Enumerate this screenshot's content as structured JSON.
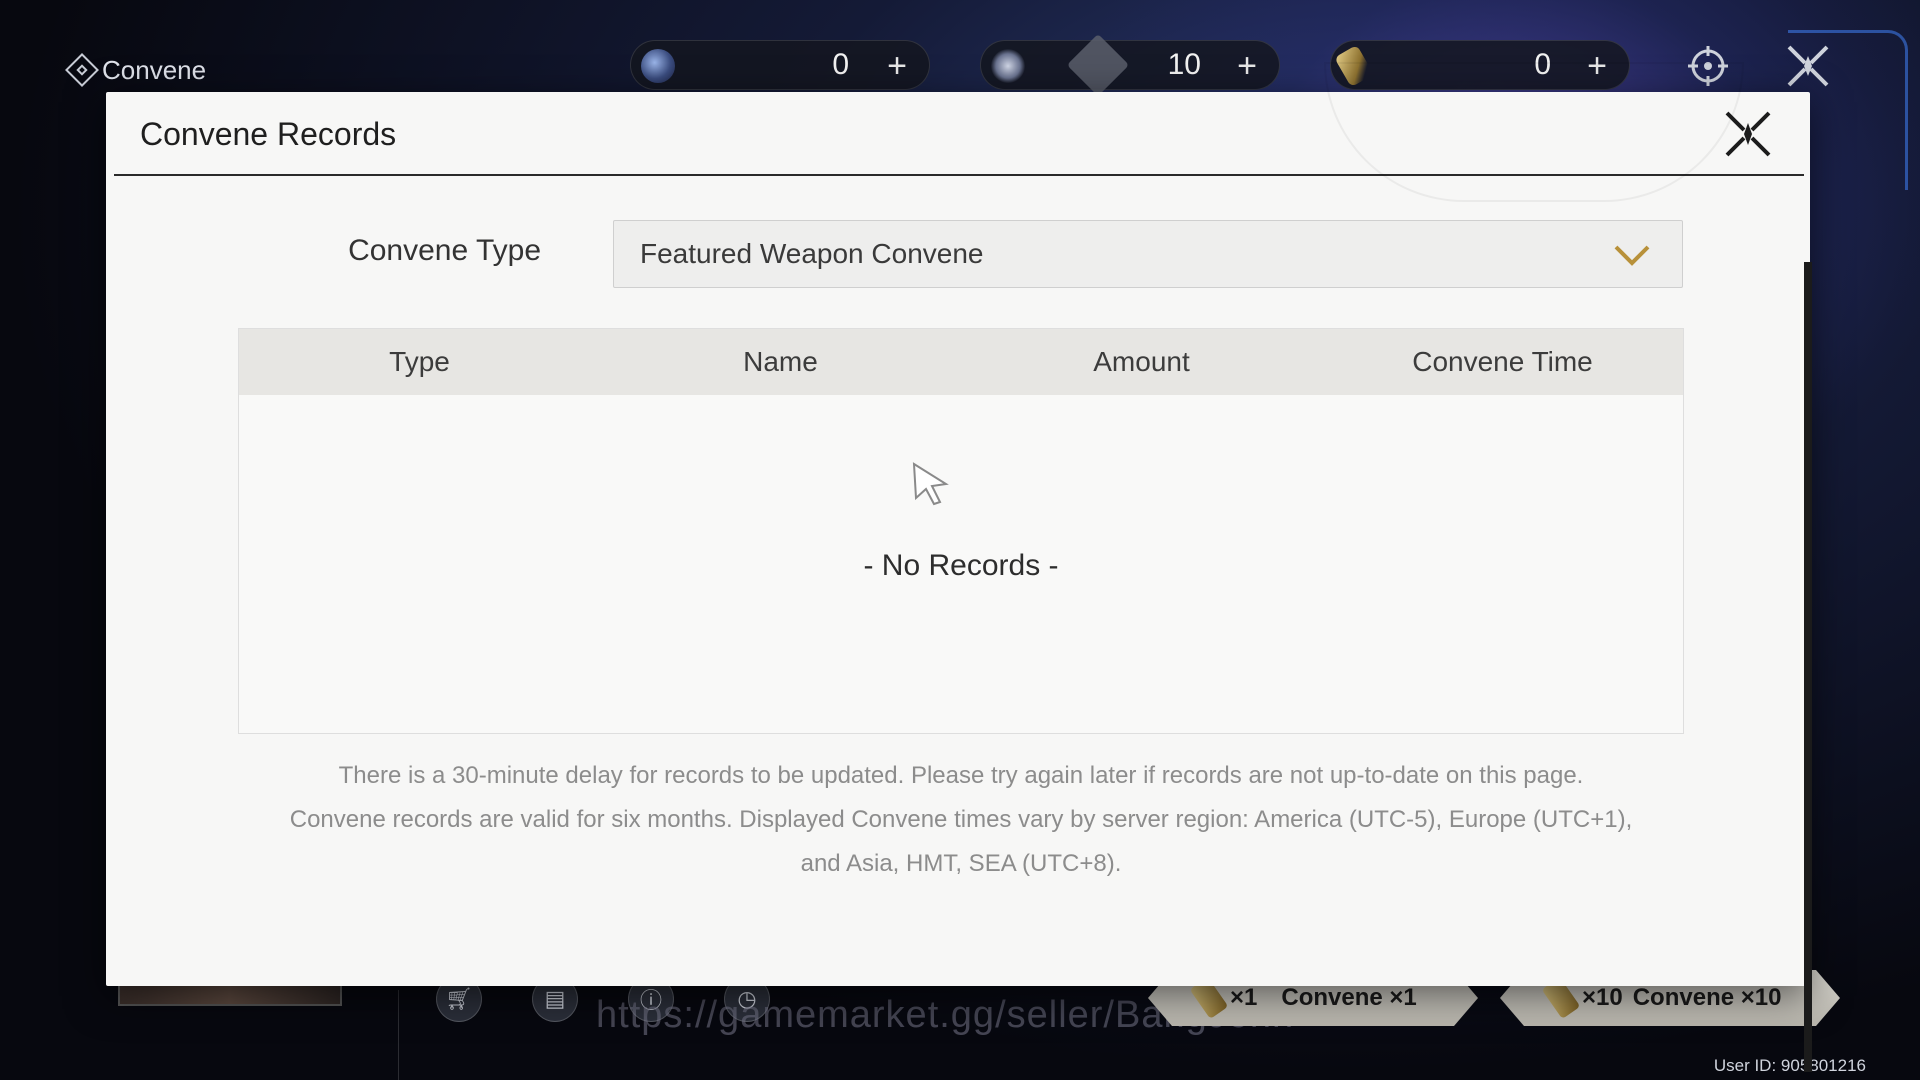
{
  "app": {
    "title": "Convene"
  },
  "currencies": [
    {
      "icon": "lustrous-tide-icon",
      "value": "0"
    },
    {
      "icon": "astrite-icon",
      "value": "10"
    },
    {
      "icon": "forging-tide-icon",
      "value": "0"
    }
  ],
  "modal": {
    "title": "Convene Records",
    "type_label": "Convene Type",
    "type_value": "Featured Weapon Convene",
    "columns": [
      "Type",
      "Name",
      "Amount",
      "Convene Time"
    ],
    "empty_text": "- No Records -",
    "notice_lines": [
      "There is a 30-minute delay for records to be updated. Please try again later if records are not up-to-date on this page.",
      "Convene records are valid for six months. Displayed Convene times vary by server region: America (UTC-5), Europe (UTC+1),",
      "and Asia, HMT, SEA (UTC+8)."
    ]
  },
  "bottom": {
    "pull_one": {
      "count": "×1",
      "label": "Convene ×1"
    },
    "pull_ten": {
      "count": "×10",
      "label": "Convene ×10"
    },
    "watermark": "https://gamemarket.gg/seller/BangJohn",
    "user_id": "User ID: 905801216"
  },
  "colors": {
    "accent_gold": "#b8913a",
    "modal_bg": "#f7f7f6"
  }
}
